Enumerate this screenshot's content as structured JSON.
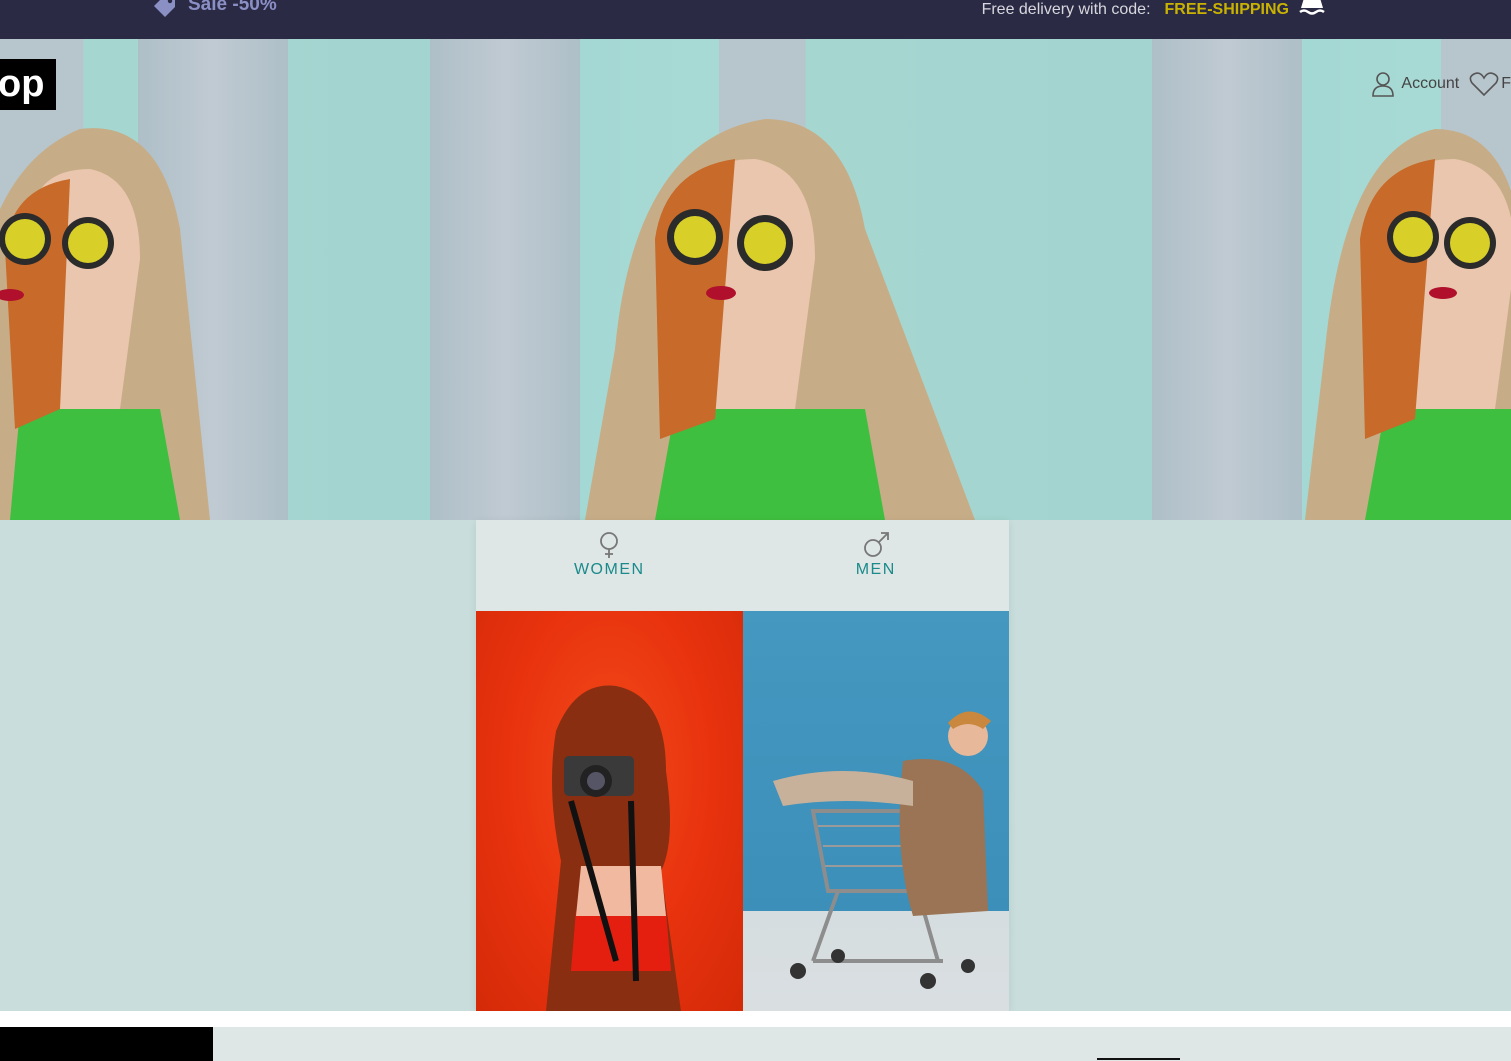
{
  "topbar": {
    "sale_label": "Sale -50%",
    "delivery_text": "Free delivery with code:",
    "delivery_code": "FREE-SHIPPING"
  },
  "header": {
    "logo_text": "op",
    "account_label": "Account",
    "favorites_label": "F"
  },
  "categories": [
    {
      "label": "WOMEN",
      "icon": "female-icon"
    },
    {
      "label": "MEN",
      "icon": "male-icon"
    }
  ],
  "colors": {
    "topbar_bg": "#2b2a45",
    "accent_code": "#c9b300",
    "category_label": "#1a8a8a",
    "page_bg": "#c8dddc"
  }
}
